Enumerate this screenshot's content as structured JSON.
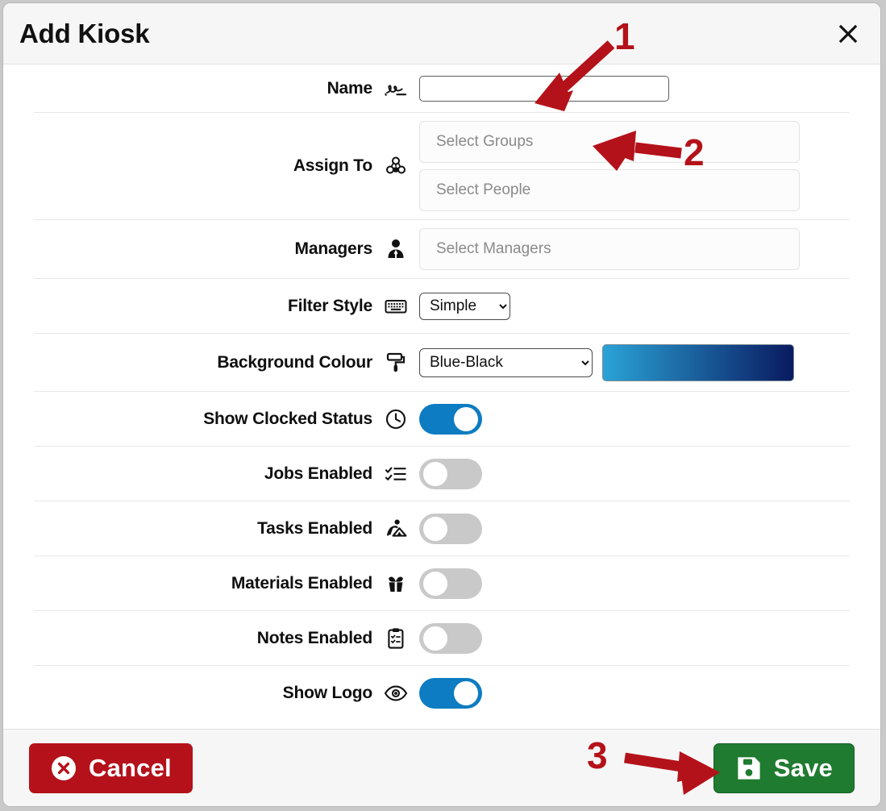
{
  "dialog": {
    "title": "Add Kiosk",
    "close_label": "×"
  },
  "fields": [
    {
      "label": "Name",
      "icon": "signature-icon",
      "type": "text",
      "value": "",
      "placeholder": ""
    },
    {
      "label": "Assign To",
      "icon": "people-group-icon",
      "type": "multi-token",
      "inputs": [
        {
          "name": "groups",
          "placeholder": "Select Groups",
          "value": ""
        },
        {
          "name": "people",
          "placeholder": "Select People",
          "value": ""
        }
      ]
    },
    {
      "label": "Managers",
      "icon": "manager-person-icon",
      "type": "token",
      "placeholder": "Select Managers",
      "value": ""
    },
    {
      "label": "Filter Style",
      "icon": "keyboard-icon",
      "type": "select",
      "value": "Simple",
      "options": [
        "Simple"
      ]
    },
    {
      "label": "Background Colour",
      "icon": "paint-roller-icon",
      "type": "select-with-swatch",
      "value": "Blue-Black",
      "options": [
        "Blue-Black"
      ],
      "swatch": {
        "from": "#2aa3d6",
        "to": "#0a1a60"
      }
    },
    {
      "label": "Show Clocked Status",
      "icon": "clock-icon",
      "type": "toggle",
      "state": "on"
    },
    {
      "label": "Jobs Enabled",
      "icon": "checklist-icon",
      "type": "toggle",
      "state": "off"
    },
    {
      "label": "Tasks Enabled",
      "icon": "worker-icon",
      "type": "toggle",
      "state": "off"
    },
    {
      "label": "Materials Enabled",
      "icon": "open-box-icon",
      "type": "toggle",
      "state": "off"
    },
    {
      "label": "Notes Enabled",
      "icon": "clipboard-icon",
      "type": "toggle",
      "state": "off"
    },
    {
      "label": "Show Logo",
      "icon": "eye-icon",
      "type": "toggle",
      "state": "on"
    }
  ],
  "footer": {
    "cancel_label": "Cancel",
    "save_label": "Save"
  },
  "annotations": [
    {
      "number": "1",
      "target": "name-input"
    },
    {
      "number": "2",
      "target": "select-groups-input"
    },
    {
      "number": "3",
      "target": "save-button"
    }
  ],
  "colors": {
    "toggle_on": "#0d7cc2",
    "toggle_off": "#c9c9c9",
    "cancel": "#b4111a",
    "save": "#1f7b30",
    "annotation": "#b4121a"
  }
}
